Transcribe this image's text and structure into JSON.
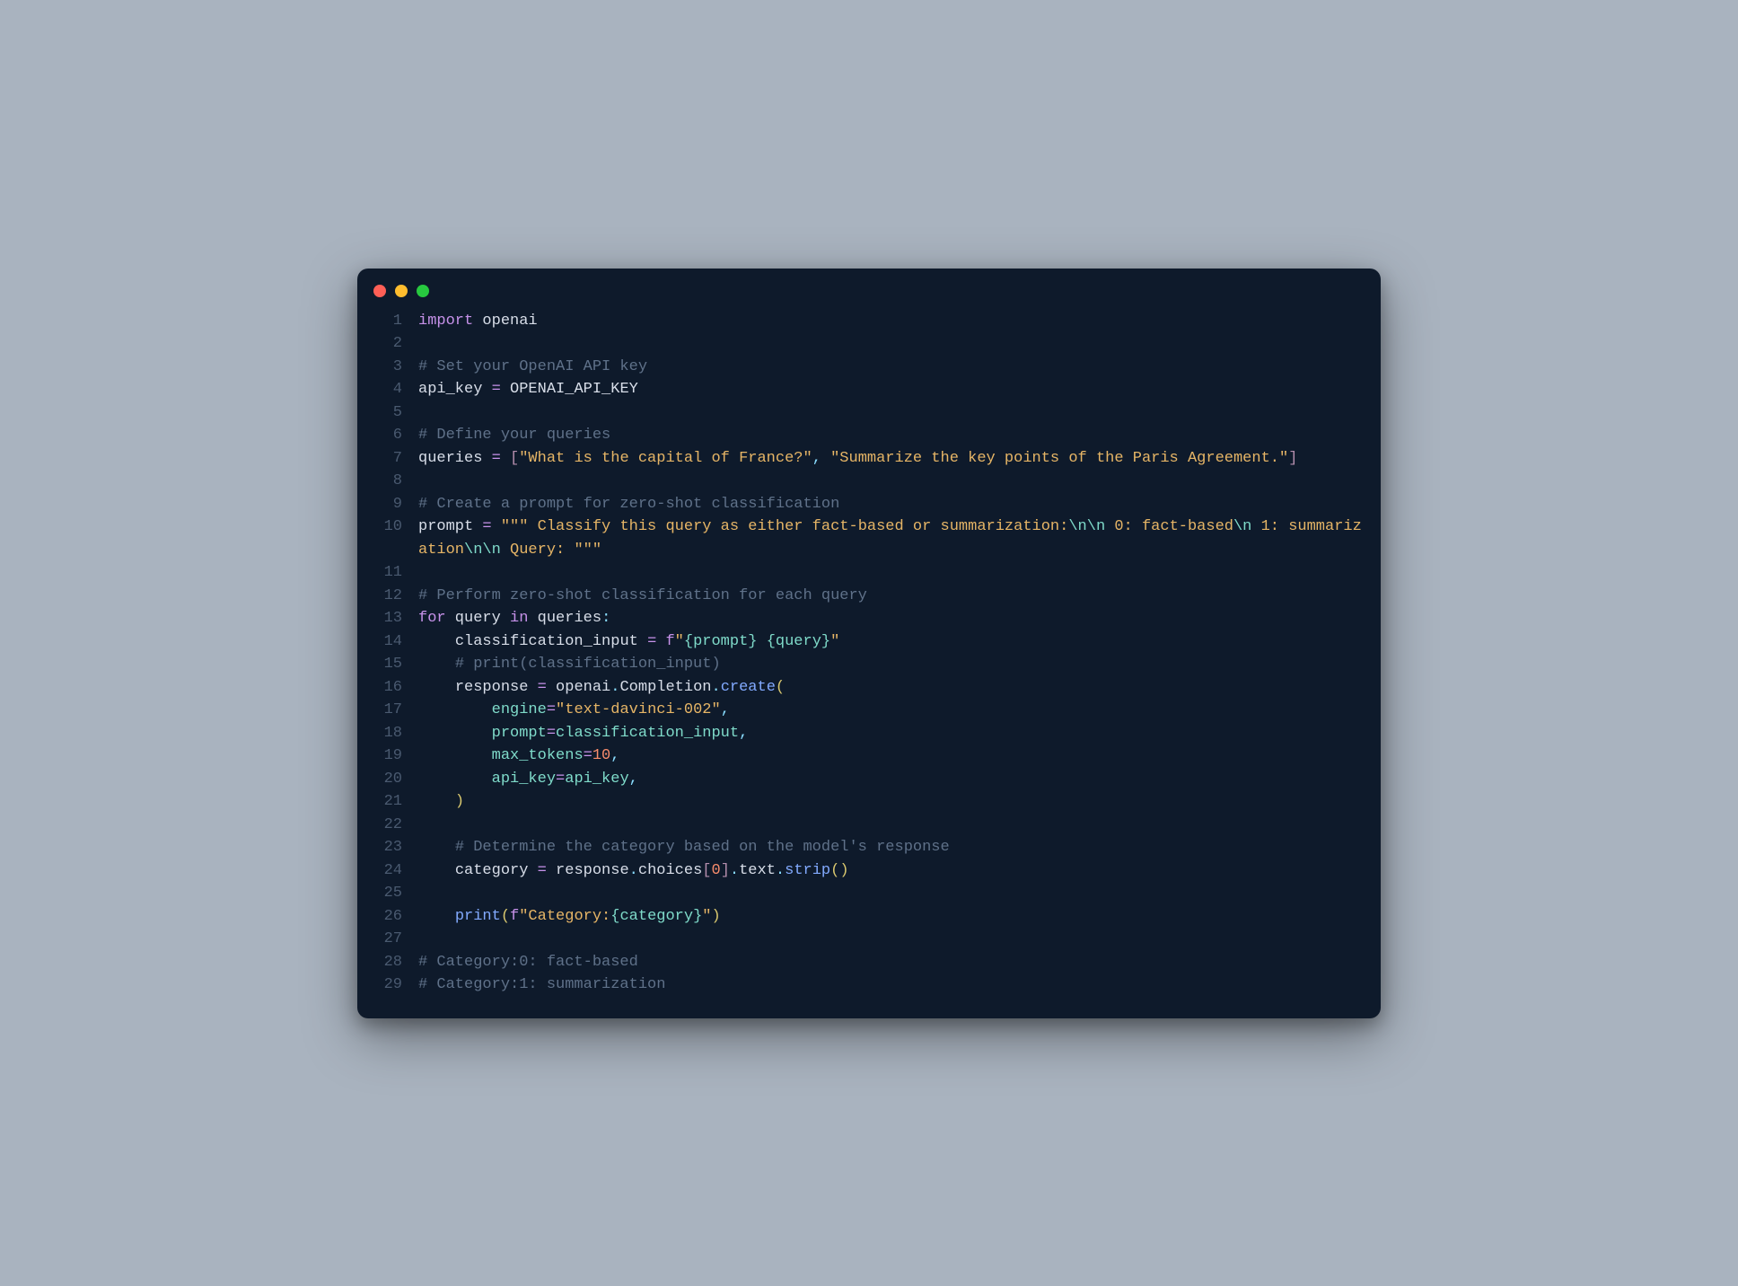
{
  "window": {
    "dots": [
      "red",
      "yellow",
      "green"
    ]
  },
  "code": {
    "lines": [
      {
        "n": "1",
        "t": [
          [
            "kw",
            "import"
          ],
          [
            "id",
            " openai"
          ]
        ]
      },
      {
        "n": "2",
        "t": []
      },
      {
        "n": "3",
        "t": [
          [
            "cmt",
            "# Set your OpenAI API key"
          ]
        ]
      },
      {
        "n": "4",
        "t": [
          [
            "id",
            "api_key "
          ],
          [
            "op",
            "="
          ],
          [
            "id",
            " OPENAI_API_KEY"
          ]
        ]
      },
      {
        "n": "5",
        "t": []
      },
      {
        "n": "6",
        "t": [
          [
            "cmt",
            "# Define your queries"
          ]
        ]
      },
      {
        "n": "7",
        "t": [
          [
            "id",
            "queries "
          ],
          [
            "op",
            "="
          ],
          [
            "id",
            " "
          ],
          [
            "br",
            "["
          ],
          [
            "str",
            "\"What is the capital of France?\""
          ],
          [
            "punc",
            ", "
          ],
          [
            "str",
            "\"Summarize the key points of the Paris Agreement.\""
          ],
          [
            "br",
            "]"
          ]
        ]
      },
      {
        "n": "8",
        "t": []
      },
      {
        "n": "9",
        "t": [
          [
            "cmt",
            "# Create a prompt for zero-shot classification"
          ]
        ]
      },
      {
        "n": "10",
        "t": [
          [
            "id",
            "prompt "
          ],
          [
            "op",
            "="
          ],
          [
            "id",
            " "
          ],
          [
            "str",
            "\"\"\" Classify this query as either fact-based or summarization:"
          ],
          [
            "esc",
            "\\n\\n"
          ],
          [
            "str",
            " 0: fact-based"
          ],
          [
            "esc",
            "\\n"
          ],
          [
            "str",
            " 1: summarization"
          ],
          [
            "esc",
            "\\n\\n"
          ],
          [
            "str",
            " Query: \"\"\""
          ]
        ]
      },
      {
        "n": "11",
        "t": []
      },
      {
        "n": "12",
        "t": [
          [
            "cmt",
            "# Perform zero-shot classification for each query"
          ]
        ]
      },
      {
        "n": "13",
        "t": [
          [
            "kw",
            "for"
          ],
          [
            "id",
            " query "
          ],
          [
            "kw",
            "in"
          ],
          [
            "id",
            " queries"
          ],
          [
            "punc",
            ":"
          ]
        ]
      },
      {
        "n": "14",
        "t": [
          [
            "id",
            "    classification_input "
          ],
          [
            "op",
            "="
          ],
          [
            "id",
            " "
          ],
          [
            "fstr",
            "f"
          ],
          [
            "str",
            "\""
          ],
          [
            "var",
            "{prompt}"
          ],
          [
            "str",
            " "
          ],
          [
            "var",
            "{query}"
          ],
          [
            "str",
            "\""
          ]
        ]
      },
      {
        "n": "15",
        "t": [
          [
            "id",
            "    "
          ],
          [
            "cmt",
            "# print(classification_input)"
          ]
        ]
      },
      {
        "n": "16",
        "t": [
          [
            "id",
            "    response "
          ],
          [
            "op",
            "="
          ],
          [
            "id",
            " openai"
          ],
          [
            "dot",
            "."
          ],
          [
            "id",
            "Completion"
          ],
          [
            "dot",
            "."
          ],
          [
            "func",
            "create"
          ],
          [
            "par",
            "("
          ]
        ]
      },
      {
        "n": "17",
        "t": [
          [
            "id",
            "        "
          ],
          [
            "var",
            "engine"
          ],
          [
            "op",
            "="
          ],
          [
            "str",
            "\"text-davinci-002\""
          ],
          [
            "punc",
            ","
          ]
        ]
      },
      {
        "n": "18",
        "t": [
          [
            "id",
            "        "
          ],
          [
            "var",
            "prompt"
          ],
          [
            "op",
            "="
          ],
          [
            "var",
            "classification_input"
          ],
          [
            "punc",
            ","
          ]
        ]
      },
      {
        "n": "19",
        "t": [
          [
            "id",
            "        "
          ],
          [
            "var",
            "max_tokens"
          ],
          [
            "op",
            "="
          ],
          [
            "num",
            "10"
          ],
          [
            "punc",
            ","
          ]
        ]
      },
      {
        "n": "20",
        "t": [
          [
            "id",
            "        "
          ],
          [
            "var",
            "api_key"
          ],
          [
            "op",
            "="
          ],
          [
            "var",
            "api_key"
          ],
          [
            "punc",
            ","
          ]
        ]
      },
      {
        "n": "21",
        "t": [
          [
            "id",
            "    "
          ],
          [
            "par",
            ")"
          ]
        ]
      },
      {
        "n": "22",
        "t": []
      },
      {
        "n": "23",
        "t": [
          [
            "id",
            "    "
          ],
          [
            "cmt",
            "# Determine the category based on the model's response"
          ]
        ]
      },
      {
        "n": "24",
        "t": [
          [
            "id",
            "    category "
          ],
          [
            "op",
            "="
          ],
          [
            "id",
            " response"
          ],
          [
            "dot",
            "."
          ],
          [
            "id",
            "choices"
          ],
          [
            "br",
            "["
          ],
          [
            "num",
            "0"
          ],
          [
            "br",
            "]"
          ],
          [
            "dot",
            "."
          ],
          [
            "id",
            "text"
          ],
          [
            "dot",
            "."
          ],
          [
            "func",
            "strip"
          ],
          [
            "par",
            "()"
          ]
        ]
      },
      {
        "n": "25",
        "t": []
      },
      {
        "n": "26",
        "t": [
          [
            "id",
            "    "
          ],
          [
            "func",
            "print"
          ],
          [
            "par",
            "("
          ],
          [
            "fstr",
            "f"
          ],
          [
            "str",
            "\"Category:"
          ],
          [
            "var",
            "{category}"
          ],
          [
            "str",
            "\""
          ],
          [
            "par",
            ")"
          ]
        ]
      },
      {
        "n": "27",
        "t": []
      },
      {
        "n": "28",
        "t": [
          [
            "cmt",
            "# Category:0: fact-based"
          ]
        ]
      },
      {
        "n": "29",
        "t": [
          [
            "cmt",
            "# Category:1: summarization"
          ]
        ]
      }
    ]
  }
}
